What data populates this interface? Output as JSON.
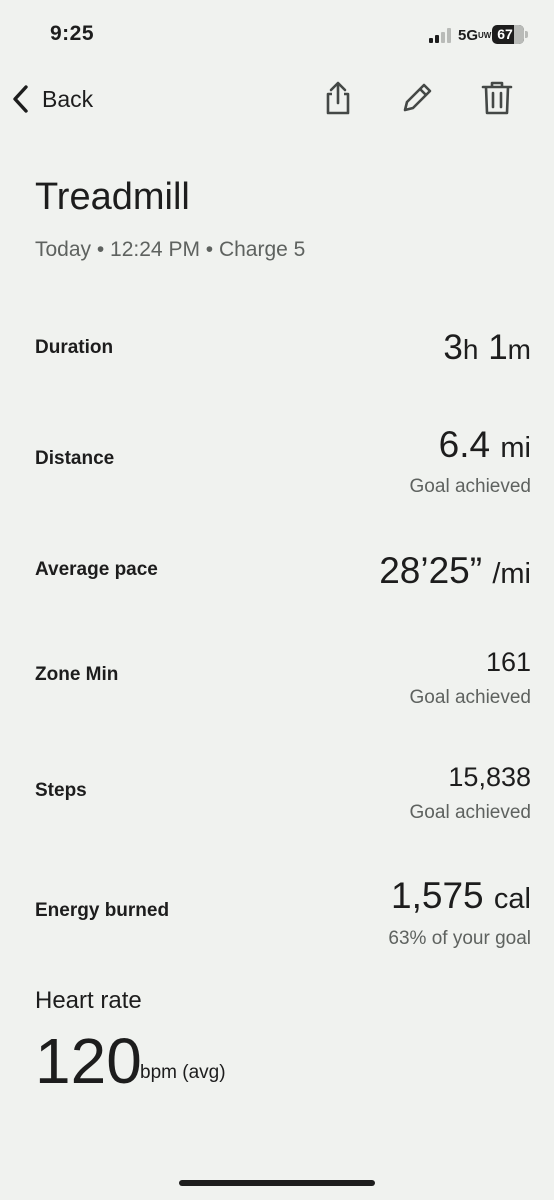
{
  "status_bar": {
    "time": "9:25",
    "network": "5G",
    "network_suffix": "UW",
    "battery": "67",
    "icons": [
      "signal-icon",
      "battery-icon"
    ]
  },
  "nav": {
    "back_label": "Back",
    "icons": [
      "chevron-left-icon",
      "share-icon",
      "edit-icon",
      "trash-icon"
    ]
  },
  "workout": {
    "title": "Treadmill",
    "subtitle": "Today • 12:24 PM • Charge 5"
  },
  "metrics": {
    "duration": {
      "label": "Duration",
      "hours": "3",
      "hours_unit": "h",
      "minutes": "1",
      "minutes_unit": "m"
    },
    "distance": {
      "label": "Distance",
      "value": "6.4",
      "unit": "mi",
      "note": "Goal achieved"
    },
    "pace": {
      "label": "Average pace",
      "value": "28’25”",
      "unit": "/mi"
    },
    "zone_min": {
      "label": "Zone Min",
      "value": "161",
      "note": "Goal achieved"
    },
    "steps": {
      "label": "Steps",
      "value": "15,838",
      "note": "Goal achieved"
    },
    "energy": {
      "label": "Energy burned",
      "value": "1,575",
      "unit": "cal",
      "note": "63% of your goal"
    }
  },
  "heart_rate": {
    "label": "Heart rate",
    "value": "120",
    "unit": "bpm (avg)"
  },
  "colors": {
    "background": "#f0f2ef",
    "text": "#1d1d1d",
    "secondary_text": "#5e625f"
  }
}
